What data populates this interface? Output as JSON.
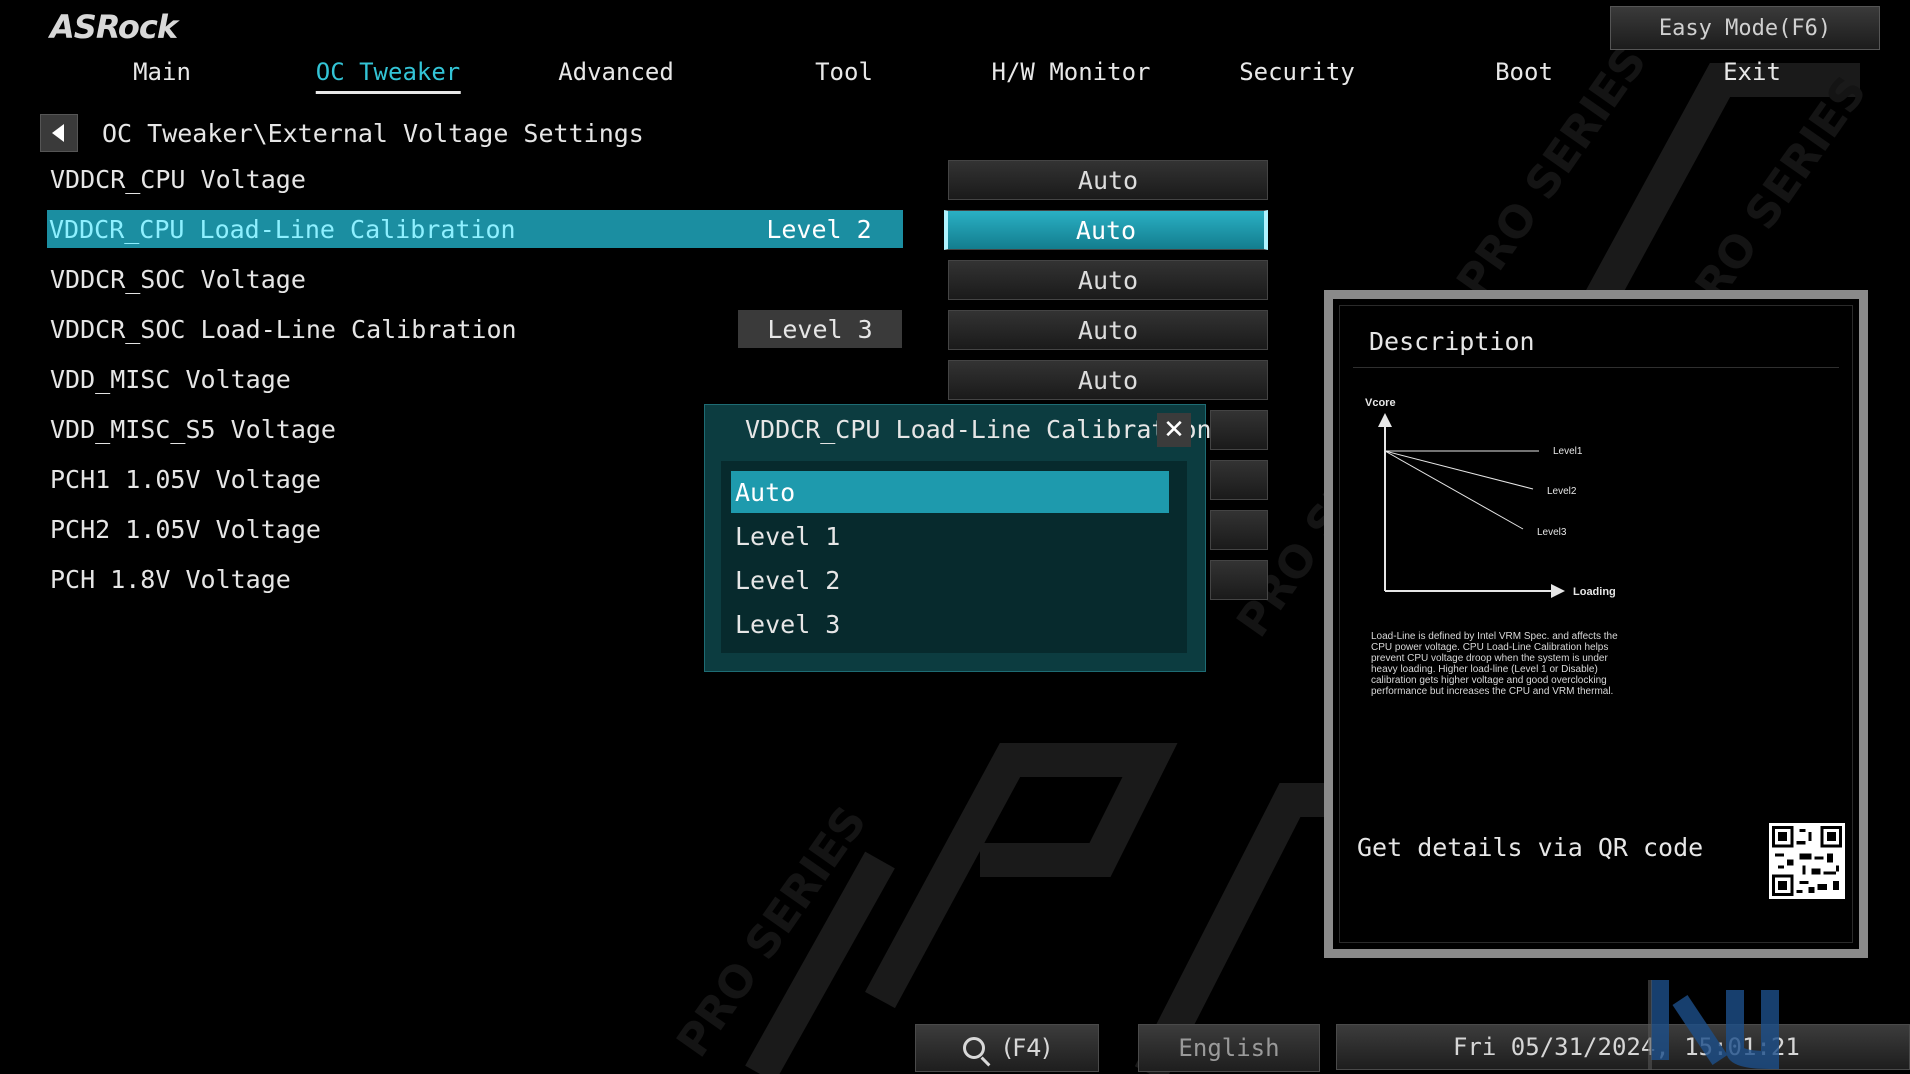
{
  "brand": {
    "logo": "ASRock"
  },
  "header": {
    "easy_mode": "Easy Mode(F6)"
  },
  "nav": {
    "tabs": [
      {
        "label": "Main"
      },
      {
        "label": "OC Tweaker",
        "active": true
      },
      {
        "label": "Advanced"
      },
      {
        "label": "Tool"
      },
      {
        "label": "H/W Monitor"
      },
      {
        "label": "Security"
      },
      {
        "label": "Boot"
      },
      {
        "label": "Exit"
      }
    ]
  },
  "breadcrumb": {
    "path": "OC Tweaker\\External Voltage Settings"
  },
  "settings": [
    {
      "label": "VDDCR_CPU Voltage",
      "current": "",
      "option": "Auto"
    },
    {
      "label": "VDDCR_CPU Load-Line Calibration",
      "current": "Level 2",
      "option": "Auto",
      "selected": true
    },
    {
      "label": "VDDCR_SOC Voltage",
      "current": "",
      "option": "Auto"
    },
    {
      "label": "VDDCR_SOC Load-Line Calibration",
      "current": "Level 3",
      "option": "Auto"
    },
    {
      "label": "VDD_MISC Voltage",
      "current": "",
      "option": "Auto"
    },
    {
      "label": "VDD_MISC_S5 Voltage",
      "current": "",
      "option": ""
    },
    {
      "label": "PCH1 1.05V Voltage",
      "current": "",
      "option": ""
    },
    {
      "label": "PCH2 1.05V Voltage",
      "current": "",
      "option": ""
    },
    {
      "label": "PCH 1.8V Voltage",
      "current": "",
      "option": ""
    }
  ],
  "popup": {
    "title": "VDDCR_CPU Load-Line Calibration",
    "close": "✕",
    "options": [
      "Auto",
      "Level 1",
      "Level 2",
      "Level 3"
    ],
    "selected_index": 0
  },
  "description": {
    "title": "Description",
    "chart": {
      "ylabel": "Vcore",
      "xlabel": "Loading",
      "lines": [
        "Level1",
        "Level2",
        "Level3"
      ]
    },
    "text": "Load-Line is defined by Intel VRM Spec. and affects the CPU power voltage. CPU Load-Line Calibration helps prevent CPU voltage droop when the system is under heavy loading. Higher load-line (Level 1 or Disable) calibration gets higher voltage and good overclocking performance but increases the CPU and VRM thermal.",
    "qr_text": "Get details via QR code"
  },
  "footer": {
    "search_key": "(F4)",
    "language": "English",
    "datetime": "Fri 05/31/2024, 15:01:21"
  },
  "colors": {
    "accent": "#1b8ea1",
    "accent_text": "#33c4d6",
    "popup_bg": "#0c3c40"
  }
}
